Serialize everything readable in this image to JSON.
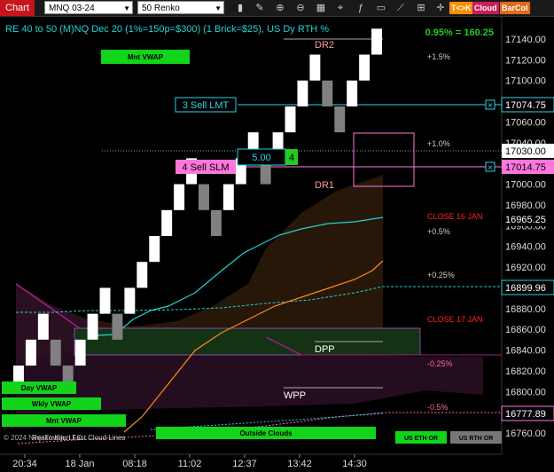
{
  "toolbar": {
    "chart_tab": "Chart",
    "instrument": "MNQ 03-24",
    "bar_type": "50 Renko",
    "tko_label": "T<>K",
    "cloud_label": "Cloud",
    "barcol_label": "BarCol",
    "icons": [
      "bar-style-icon",
      "draw-icon",
      "zoom-in-icon",
      "zoom-out-icon",
      "properties-icon",
      "strategies-icon",
      "indicators-icon",
      "templates-icon",
      "drawing-tools-icon",
      "data-box-icon"
    ]
  },
  "chart": {
    "header": "RE 40 to 50 (M)NQ Dec 20 (1%=150p=$300) (1 Brick=$25), US Dy RTH %",
    "pct_badge": "0.95% = 160.25",
    "bg": "#000000",
    "colors": {
      "up_brick": "#ffffff",
      "down_brick": "#808080",
      "cyan_line": "#22d3d3",
      "orange_line": "#ff8c1a",
      "sell_lmt": "#2ad4e8",
      "sell_slm": "#ff77dd",
      "price_box": "#ffffff"
    }
  },
  "chart_data": {
    "type": "renko",
    "x_ticks": [
      "20:34",
      "18 Jan",
      "08:18",
      "11:02",
      "12:37",
      "13:42",
      "14:30"
    ],
    "y_ticks": [
      "17140.00",
      "17120.00",
      "17100.00",
      "17080.00",
      "17060.00",
      "17040.00",
      "17020.00",
      "17000.00",
      "16980.00",
      "16960.00",
      "16940.00",
      "16920.00",
      "16900.00",
      "16880.00",
      "16860.00",
      "16840.00",
      "16820.00",
      "16800.00",
      "16780.00",
      "16760.00"
    ],
    "ylim": [
      16750,
      17150
    ],
    "bricks": [
      {
        "type": "up",
        "low": 16800,
        "high": 16825
      },
      {
        "type": "up",
        "low": 16825,
        "high": 16850
      },
      {
        "type": "up",
        "low": 16850,
        "high": 16875
      },
      {
        "type": "down",
        "low": 16825,
        "high": 16850
      },
      {
        "type": "down",
        "low": 16800,
        "high": 16825
      },
      {
        "type": "up",
        "low": 16825,
        "high": 16850
      },
      {
        "type": "up",
        "low": 16850,
        "high": 16875
      },
      {
        "type": "up",
        "low": 16875,
        "high": 16900
      },
      {
        "type": "down",
        "low": 16850,
        "high": 16875
      },
      {
        "type": "up",
        "low": 16875,
        "high": 16900
      },
      {
        "type": "up",
        "low": 16900,
        "high": 16925
      },
      {
        "type": "up",
        "low": 16925,
        "high": 16950
      },
      {
        "type": "up",
        "low": 16950,
        "high": 16975
      },
      {
        "type": "up",
        "low": 16975,
        "high": 17000
      },
      {
        "type": "up",
        "low": 17000,
        "high": 17025
      },
      {
        "type": "down",
        "low": 16975,
        "high": 17000
      },
      {
        "type": "down",
        "low": 16950,
        "high": 16975
      },
      {
        "type": "up",
        "low": 16975,
        "high": 17000
      },
      {
        "type": "up",
        "low": 17000,
        "high": 17025
      },
      {
        "type": "up",
        "low": 17025,
        "high": 17050
      },
      {
        "type": "down",
        "low": 17000,
        "high": 17025
      },
      {
        "type": "up",
        "low": 17025,
        "high": 17050
      },
      {
        "type": "up",
        "low": 17050,
        "high": 17075
      },
      {
        "type": "up",
        "low": 17075,
        "high": 17100
      },
      {
        "type": "up",
        "low": 17100,
        "high": 17125
      },
      {
        "type": "down",
        "low": 17075,
        "high": 17100
      },
      {
        "type": "down",
        "low": 17050,
        "high": 17075
      },
      {
        "type": "up",
        "low": 17075,
        "high": 17100
      },
      {
        "type": "up",
        "low": 17100,
        "high": 17125
      },
      {
        "type": "up",
        "low": 17125,
        "high": 17150
      }
    ],
    "price_marks": {
      "sell_lmt": {
        "label": "3 Sell LMT",
        "price": "17074.75"
      },
      "sell_slm": {
        "label": "4 Sell SLM",
        "price": "17014.75"
      },
      "last_price": "17030.00",
      "order_qty": "5.00",
      "order_count": "4",
      "close16": "16965.25",
      "cyan_level": "16899.96",
      "pink_level": "16777.89"
    },
    "level_labels": {
      "dr2": "DR2",
      "dr1": "DR1",
      "dpp": "DPP",
      "wpp": "WPP",
      "p15": "+1.5%",
      "p10": "+1.0%",
      "p05": "+0.5%",
      "p025": "+0.25%",
      "m025": "-0.25%",
      "m05": "-0.5%",
      "close16": "CLOSE 16 JAN",
      "close17": "CLOSE 17 JAN"
    }
  },
  "badges": {
    "mnt_vwap_top": "Mnt VWAP",
    "day_vwap": "Day VWAP",
    "wkly_vwap": "Wkly VWAP",
    "mnt_vwap": "Mnt VWAP",
    "outside_clouds": "Outside Clouds",
    "us_eth": "US ETH OR",
    "us_rth": "US RTH OR"
  },
  "footer": {
    "copyright": "© 2024 NinjaTrader, LLC",
    "indicator_name": "Renko Kijun Fast Cloud Lines"
  }
}
